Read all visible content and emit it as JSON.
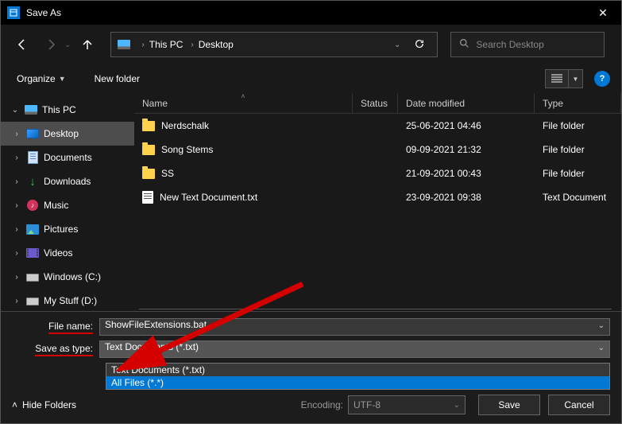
{
  "title": "Save As",
  "breadcrumb": {
    "root": "This PC",
    "leaf": "Desktop"
  },
  "search": {
    "placeholder": "Search Desktop"
  },
  "toolbar": {
    "organize": "Organize",
    "new_folder": "New folder"
  },
  "tree": {
    "root": "This PC",
    "items": [
      {
        "label": "Desktop"
      },
      {
        "label": "Documents"
      },
      {
        "label": "Downloads"
      },
      {
        "label": "Music"
      },
      {
        "label": "Pictures"
      },
      {
        "label": "Videos"
      },
      {
        "label": "Windows (C:)"
      },
      {
        "label": "My Stuff (D:)"
      }
    ]
  },
  "columns": {
    "name": "Name",
    "status": "Status",
    "date": "Date modified",
    "type": "Type"
  },
  "files": [
    {
      "name": "Nerdschalk",
      "date": "25-06-2021 04:46",
      "type": "File folder",
      "kind": "folder"
    },
    {
      "name": "Song Stems",
      "date": "09-09-2021 21:32",
      "type": "File folder",
      "kind": "folder"
    },
    {
      "name": "SS",
      "date": "21-09-2021 00:43",
      "type": "File folder",
      "kind": "folder"
    },
    {
      "name": "New Text Document.txt",
      "date": "23-09-2021 09:38",
      "type": "Text Document",
      "kind": "txt"
    }
  ],
  "fields": {
    "filename_label": "File name:",
    "filename_value": "ShowFileExtensions.bat",
    "saveastype_label": "Save as type:",
    "saveastype_value": "Text Documents (*.txt)",
    "options": [
      "Text Documents (*.txt)",
      "All Files  (*.*)"
    ]
  },
  "footer": {
    "hide_folders": "Hide Folders",
    "encoding_label": "Encoding:",
    "encoding_value": "UTF-8",
    "save": "Save",
    "cancel": "Cancel"
  }
}
